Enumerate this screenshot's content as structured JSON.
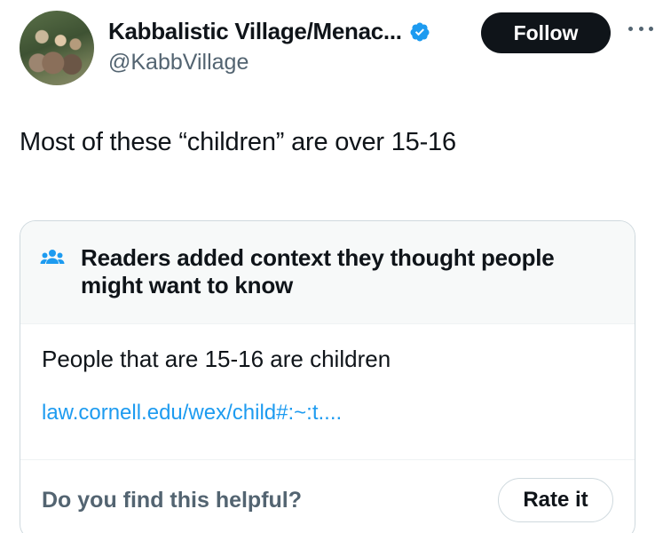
{
  "author": {
    "display_name": "Kabbalistic Village/Menac...",
    "handle": "@KabbVillage",
    "verified": true,
    "verified_color": "#1d9bf0"
  },
  "actions": {
    "follow_label": "Follow",
    "more_icon": "more-horizontal-icon"
  },
  "tweet": {
    "text": "Most of these “children” are over 15-16"
  },
  "community_note": {
    "header_icon": "readers-icon",
    "title": "Readers added context they thought people might want to know",
    "text": "People that are 15-16 are children",
    "link": "law.cornell.edu/wex/child#:~:t....",
    "link_color": "#1d9bf0",
    "prompt": "Do you find this helpful?",
    "rate_label": "Rate it"
  }
}
